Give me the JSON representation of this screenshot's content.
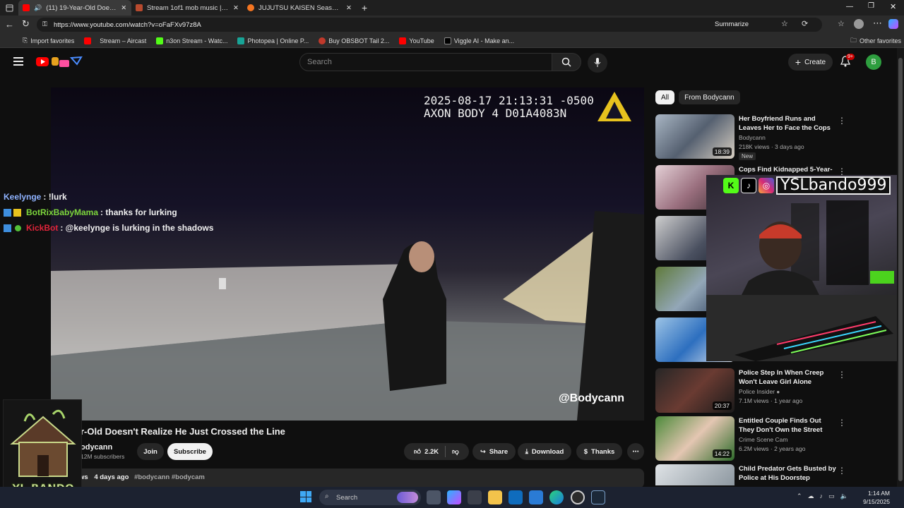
{
  "browser": {
    "tabs": [
      {
        "label": "(11) 19-Year-Old Doesn't Re...",
        "active": true
      },
      {
        "label": "Stream 1of1 mob music | Listen t..."
      },
      {
        "label": "JUJUTSU KAISEN Season 2 (Engli..."
      }
    ],
    "url": "https://www.youtube.com/watch?v=oFaFXv97z8A",
    "summarize_label": "Summarize",
    "favorites": [
      {
        "label": "Import favorites"
      },
      {
        "label": "Stream – Aircast"
      },
      {
        "label": "n3on Stream - Watc..."
      },
      {
        "label": "Photopea | Online P..."
      },
      {
        "label": "Buy OBSBOT Tail 2..."
      },
      {
        "label": "YouTube"
      },
      {
        "label": "Viggle AI - Make an..."
      }
    ],
    "other_favorites": "Other favorites"
  },
  "youtube": {
    "search_placeholder": "Search",
    "create_label": "Create",
    "notification_count": "9+",
    "avatar_letter": "B"
  },
  "video": {
    "timestamp_line1": "2025-08-17 21:13:31 -0500",
    "timestamp_line2": "AXON BODY 4 D01A4083N",
    "watermark": "@Bodycann",
    "title": "r-Old Doesn't Realize He Just Crossed the Line",
    "channel": "odycann",
    "subscribers": "12M subscribers",
    "join_label": "Join",
    "subscribe_label": "Subscribe",
    "likes": "2.2K",
    "share_label": "Share",
    "download_label": "Download",
    "thanks_label": "Thanks",
    "desc_views": "ws",
    "desc_age": "4 days ago",
    "desc_tags": "#bodycann #bodycam"
  },
  "chat": [
    {
      "user": "Keelynge",
      "message": ": !lurk",
      "color": "#8fb3ff"
    },
    {
      "user": "BotRixBabyMama",
      "message": ": thanks for lurking",
      "color": "#7dd63c"
    },
    {
      "user": "KickBot",
      "message": ": @keelynge is lurking in the shadows",
      "color": "#e0243a"
    }
  ],
  "sidebar": {
    "chips": [
      "All",
      "From Bodycann"
    ],
    "recommendations": [
      {
        "title": "Her Boyfriend Runs and Leaves Her to Face the Cops",
        "channel": "Bodycann",
        "meta": "218K views · 3 days ago",
        "badge": "New",
        "duration": "18:39"
      },
      {
        "title": "Cops Find Kidnapped 5-Year-",
        "channel": "",
        "meta": "",
        "duration": ""
      },
      {
        "title": "",
        "channel": "",
        "meta": "",
        "duration": ""
      },
      {
        "title": "",
        "channel": "",
        "meta": "",
        "duration": ""
      },
      {
        "title": "",
        "channel": "",
        "meta": "",
        "duration": ""
      },
      {
        "title": "Police Step In When Creep Won't Leave Girl Alone",
        "channel": "Police Insider",
        "meta": "7.1M views · 1 year ago",
        "duration": "20:37"
      },
      {
        "title": "Entitled Couple Finds Out They Don't Own the Street",
        "channel": "Crime Scene Cam",
        "meta": "6.2M views · 2 years ago",
        "duration": "14:22"
      },
      {
        "title": "Child Predator Gets Busted by Police at His Doorstep",
        "channel": "",
        "meta": "",
        "duration": ""
      }
    ]
  },
  "stream_overlay": {
    "handle": "YSLbando999"
  },
  "taskbar": {
    "search_label": "Search",
    "time": "1:14 AM",
    "date": "9/15/2025"
  },
  "colors": {
    "yt_red": "#ff0000",
    "kick_green": "#53fc18",
    "accent_gold": "#e7c21e"
  }
}
